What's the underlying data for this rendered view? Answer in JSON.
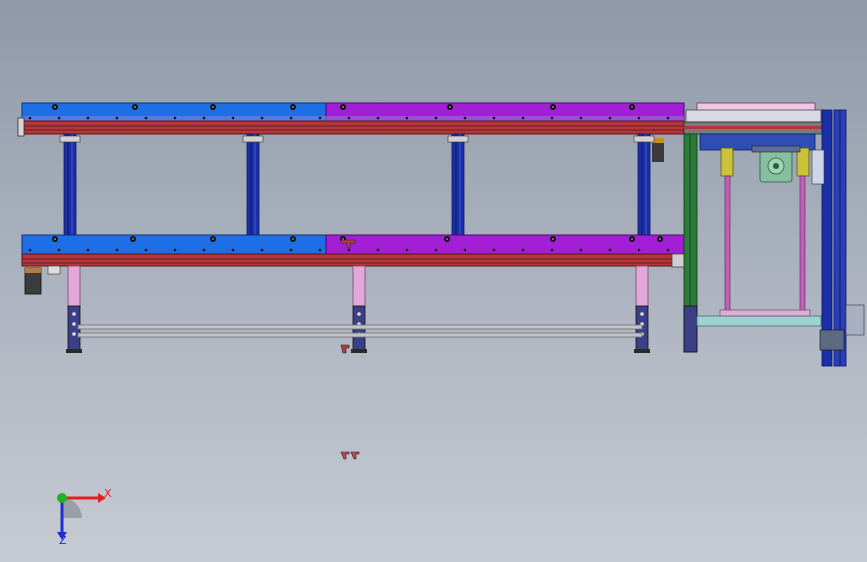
{
  "viewport": {
    "background_top": "#8f99a8",
    "background_bottom": "#c6cbd3"
  },
  "colors": {
    "plate_blue": "#1e6fe6",
    "plate_magenta": "#a21fd6",
    "rail_red": "#b3363a",
    "rail_dark": "#6b1f22",
    "post_blue": "#1b2fa6",
    "post_dark": "#0c1766",
    "leg_pink": "#e3a8d8",
    "leg_navy": "#3b3f86",
    "bar_grey": "#c2c4c8",
    "frame_green": "#2d7a3a",
    "shaft_magenta": "#c05fb8",
    "motor_green": "#86bfa0",
    "cylinder_yellow": "#c9c23a",
    "fastener_black": "#151515"
  },
  "triad": {
    "x_label": "X",
    "z_label": "Z",
    "x_color": "#e02020",
    "z_color": "#2030d0",
    "y_color": "#20b020"
  }
}
